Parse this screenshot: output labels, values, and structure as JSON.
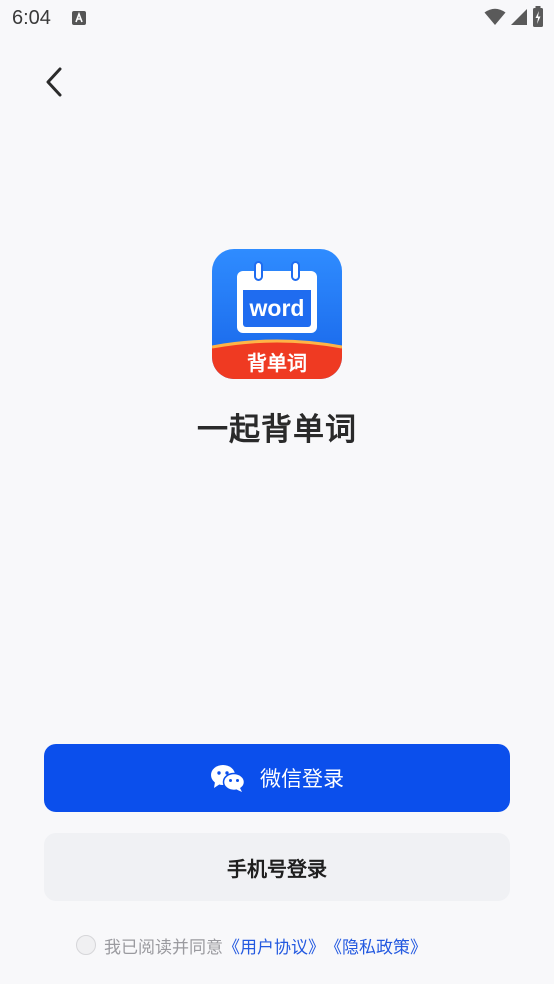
{
  "status_bar": {
    "time": "6:04"
  },
  "nav": {
    "back_icon": "chevron-left-icon"
  },
  "app": {
    "logo_word": "word",
    "logo_ribbon": "背单词",
    "name": "一起背单词"
  },
  "buttons": {
    "wechat_login": "微信登录",
    "wechat_icon": "wechat-icon",
    "phone_login": "手机号登录"
  },
  "agreement": {
    "prefix": "我已阅读并同意",
    "user_agreement": "《用户协议》",
    "privacy_policy": "《隐私政策》"
  },
  "colors": {
    "primary": "#0b4fec",
    "secondary_button_bg": "#f0f1f4",
    "link": "#2359e0",
    "ribbon": "#ef3a22"
  }
}
